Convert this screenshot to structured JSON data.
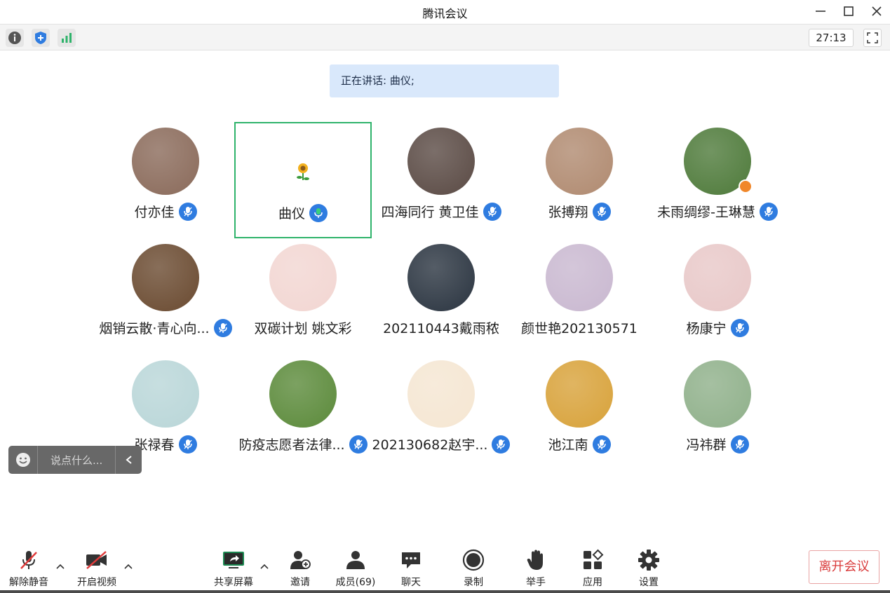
{
  "window": {
    "title": "腾讯会议"
  },
  "status": {
    "timer": "27:13"
  },
  "speaking": {
    "text": "正在讲话: 曲仪;"
  },
  "participants": [
    {
      "name": "付亦佳",
      "mic": "muted",
      "avatar_color": "#8a6a5a"
    },
    {
      "name": "曲仪",
      "mic": "speaking",
      "avatar_color": "none"
    },
    {
      "name": "四海同行 黄卫佳",
      "mic": "muted",
      "avatar_color": "#5a4a44"
    },
    {
      "name": "张搏翔",
      "mic": "muted",
      "avatar_color": "#b08a70"
    },
    {
      "name": "未雨绸缪-王琳慧",
      "mic": "muted",
      "avatar_color": "#4e7a3a",
      "host": true
    },
    {
      "name": "烟销云散·青心向...",
      "mic": "muted",
      "avatar_color": "#6a4a30"
    },
    {
      "name": "双碳计划  姚文彩",
      "mic": "none",
      "avatar_color": "#f2d6d2"
    },
    {
      "name": "202110443戴雨秾",
      "mic": "none",
      "avatar_color": "#2a3440"
    },
    {
      "name": "颜世艳202130571",
      "mic": "none",
      "avatar_color": "#c9b8d0"
    },
    {
      "name": "杨康宁",
      "mic": "muted",
      "avatar_color": "#e8c8c8"
    },
    {
      "name": "张禄春",
      "mic": "muted",
      "avatar_color": "#b9d6d8"
    },
    {
      "name": "防疫志愿者法律...",
      "mic": "muted",
      "avatar_color": "#5b8a3a"
    },
    {
      "name": "202130682赵宇...",
      "mic": "muted",
      "avatar_color": "#f5e6d2"
    },
    {
      "name": "池江南",
      "mic": "muted",
      "avatar_color": "#d8a23a"
    },
    {
      "name": "冯祎群",
      "mic": "muted",
      "avatar_color": "#8fb08a"
    }
  ],
  "chat": {
    "placeholder": "说点什么..."
  },
  "toolbar": {
    "unmute": "解除静音",
    "start_video": "开启视频",
    "share_screen": "共享屏幕",
    "invite": "邀请",
    "members": "成员(69)",
    "chat": "聊天",
    "record": "录制",
    "raise_hand": "举手",
    "apps": "应用",
    "settings": "设置",
    "leave": "离开会议"
  },
  "colors": {
    "accent": "#2f7ce0",
    "active_border": "#2fb36b",
    "leave": "#d93a3a",
    "banner": "#d9e8fb"
  }
}
